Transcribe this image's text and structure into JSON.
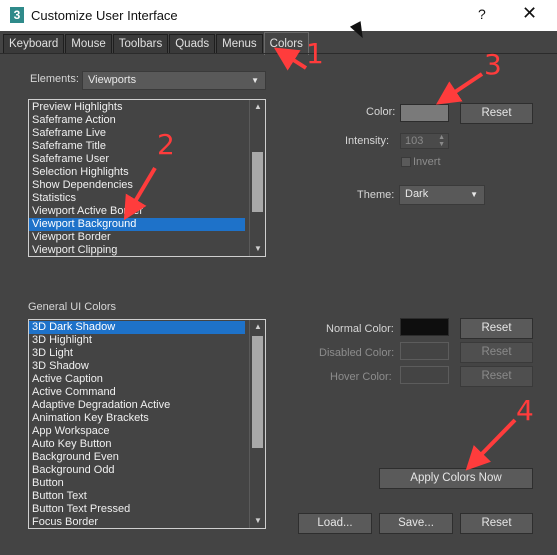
{
  "window": {
    "title": "Customize User Interface",
    "help": "?",
    "close": "✕",
    "app_icon": "3"
  },
  "tabs": [
    {
      "label": "Keyboard"
    },
    {
      "label": "Mouse"
    },
    {
      "label": "Toolbars"
    },
    {
      "label": "Quads"
    },
    {
      "label": "Menus"
    },
    {
      "label": "Colors",
      "active": true
    }
  ],
  "elements": {
    "label": "Elements:",
    "value": "Viewports",
    "items": [
      "Preview Highlights",
      "Safeframe Action",
      "Safeframe Live",
      "Safeframe Title",
      "Safeframe User",
      "Selection Highlights",
      "Show Dependencies",
      "Statistics",
      "Viewport Active Border",
      "Viewport Background",
      "Viewport Border",
      "Viewport Clipping"
    ],
    "selected_index": 9
  },
  "color_panel": {
    "color_label": "Color:",
    "color_value": "#7a7a7a",
    "reset": "Reset",
    "intensity_label": "Intensity:",
    "intensity_value": "103",
    "invert_label": "Invert",
    "theme_label": "Theme:",
    "theme_value": "Dark"
  },
  "general": {
    "label": "General UI Colors",
    "items": [
      "3D Dark Shadow",
      "3D Highlight",
      "3D Light",
      "3D Shadow",
      "Active Caption",
      "Active Command",
      "Adaptive Degradation Active",
      "Animation Key Brackets",
      "App Workspace",
      "Auto Key Button",
      "Background Even",
      "Background Odd",
      "Button",
      "Button Text",
      "Button Text Pressed",
      "Focus Border"
    ],
    "selected_index": 0,
    "normal_label": "Normal Color:",
    "normal_color": "#0e0e0e",
    "disabled_label": "Disabled Color:",
    "hover_label": "Hover Color:",
    "reset": "Reset"
  },
  "buttons": {
    "apply": "Apply Colors Now",
    "load": "Load...",
    "save": "Save...",
    "reset": "Reset"
  },
  "annotations": [
    "1",
    "2",
    "3",
    "4"
  ],
  "colors": {
    "accent": "#1e72c9",
    "annotation": "#ff3c3c",
    "background": "#444444"
  }
}
